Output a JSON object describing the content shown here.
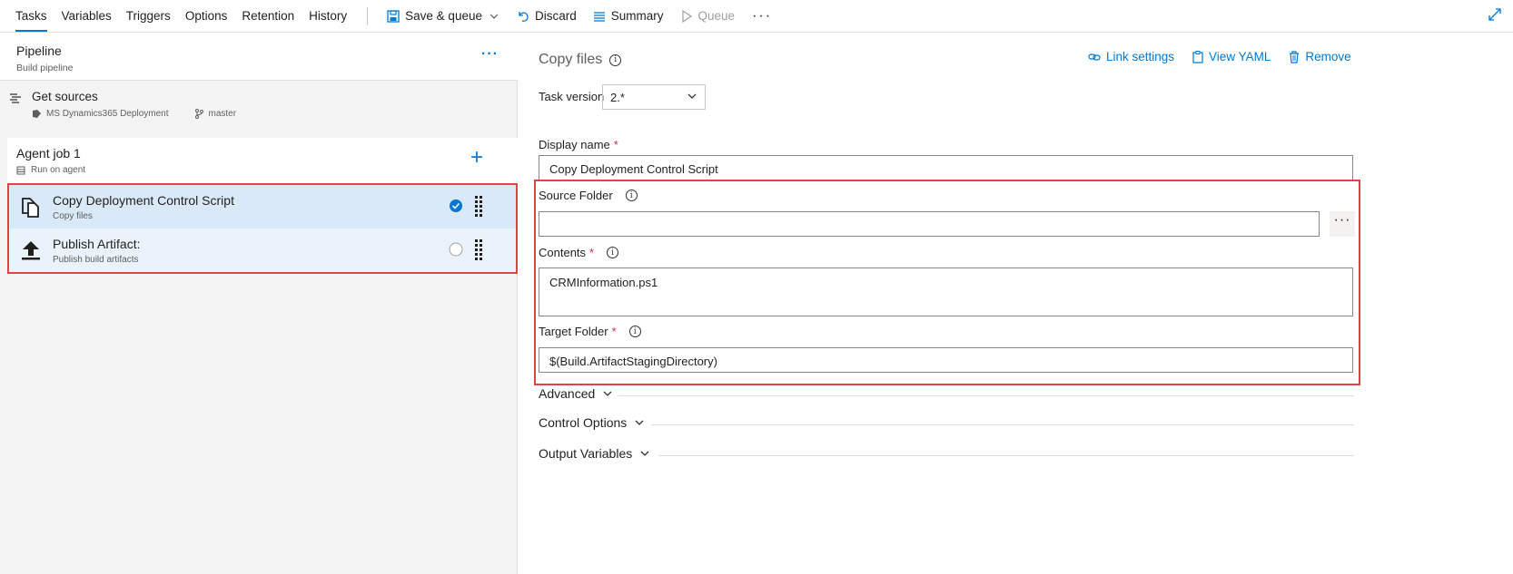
{
  "toolbar": {
    "tabs": [
      "Tasks",
      "Variables",
      "Triggers",
      "Options",
      "Retention",
      "History"
    ],
    "save_queue": "Save & queue",
    "discard": "Discard",
    "summary": "Summary",
    "queue": "Queue",
    "more": "···"
  },
  "pipeline": {
    "title": "Pipeline",
    "subtitle": "Build pipeline",
    "more": "···"
  },
  "sources": {
    "title": "Get sources",
    "repo": "MS Dynamics365 Deployment",
    "branch": "master"
  },
  "agent": {
    "title": "Agent job 1",
    "subtitle": "Run on agent",
    "add": "+"
  },
  "tasks": [
    {
      "title": "Copy Deployment Control Script",
      "subtitle": "Copy files",
      "selected": true
    },
    {
      "title": "Publish Artifact:",
      "subtitle": "Publish build artifacts",
      "selected": false
    }
  ],
  "detail": {
    "title": "Copy files",
    "links": {
      "link_settings": "Link settings",
      "view_yaml": "View YAML",
      "remove": "Remove"
    },
    "task_version_label": "Task version",
    "task_version_value": "2.*",
    "display_name_label": "Display name",
    "display_name_value": "Copy Deployment Control Script",
    "source_folder_label": "Source Folder",
    "source_folder_value": "",
    "browse": "···",
    "contents_label": "Contents",
    "contents_value": "CRMInformation.ps1",
    "target_folder_label": "Target Folder",
    "target_folder_value": "$(Build.ArtifactStagingDirectory)",
    "required_mark": "*",
    "info_mark": "i",
    "sections": [
      "Advanced",
      "Control Options",
      "Output Variables"
    ]
  },
  "colors": {
    "accent": "#0078d4",
    "highlight": "#e04343",
    "required": "#c4314b"
  }
}
